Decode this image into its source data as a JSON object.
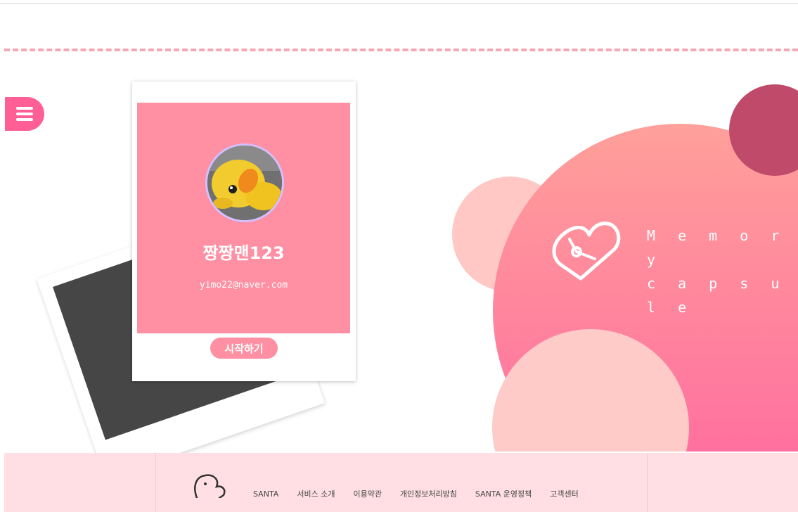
{
  "profile": {
    "username": "짱짱맨123",
    "email": "yimo22@naver.com",
    "start_label": "시작하기"
  },
  "brand": {
    "line1": "M e m o r y",
    "line2": "c a p s u l e"
  },
  "footer": {
    "links": [
      "SANTA",
      "서비스 소개",
      "이용약관",
      "개인정보처리방침",
      "SANTA 운영정책",
      "고객센터"
    ]
  },
  "colors": {
    "accent": "#ff5f95",
    "card_pink": "#ff8fa2",
    "footer_bg": "#ffdfe4",
    "avatar_ring": "#d4bfff"
  },
  "icons": {
    "menu": "hamburger-menu-icon",
    "brand": "heart-clock-logo-icon",
    "footer": "duck-logo-icon"
  }
}
